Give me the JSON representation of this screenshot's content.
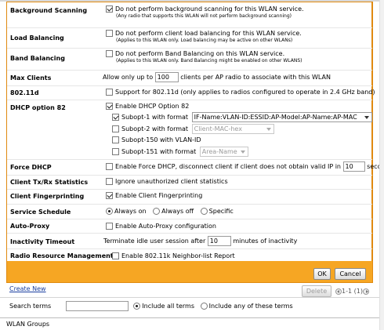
{
  "settings": {
    "background_scanning": {
      "label": "Background Scanning",
      "checked": true,
      "text": "Do not perform background scanning for this WLAN service.",
      "note": "(Any radio that supports this WLAN will not perform background scanning)"
    },
    "load_balancing": {
      "label": "Load Balancing",
      "checked": false,
      "text": "Do not perform client load balancing for this WLAN service.",
      "note": "(Applies to this WLAN only. Load balancing may be active on other WLANs)"
    },
    "band_balancing": {
      "label": "Band Balancing",
      "checked": false,
      "text": "Do not perform Band Balancing on this WLAN service.",
      "note": "(Applies to this WLAN only. Band Balancing might be enabled on other WLANS)"
    },
    "max_clients": {
      "label": "Max Clients",
      "prefix": "Allow only up to",
      "value": "100",
      "suffix": "clients per AP radio to associate with this WLAN"
    },
    "dot11d": {
      "label": "802.11d",
      "checked": false,
      "text": "Support for 802.11d (only applies to radios configured to operate in 2.4 GHz band)"
    },
    "dhcp82": {
      "label": "DHCP option 82",
      "enable": {
        "checked": true,
        "text": "Enable DHCP Option 82"
      },
      "subopt1": {
        "checked": true,
        "text": "Subopt-1 with format",
        "select": "IF-Name:VLAN-ID:ESSID:AP-Model:AP-Name:AP-MAC"
      },
      "subopt2": {
        "checked": false,
        "text": "Subopt-2 with format",
        "select": "Client-MAC-hex"
      },
      "subopt150": {
        "checked": false,
        "text": "Subopt-150 with VLAN-ID"
      },
      "subopt151": {
        "checked": false,
        "text": "Subopt-151 with format",
        "select": "Area-Name"
      }
    },
    "force_dhcp": {
      "label": "Force DHCP",
      "checked": false,
      "text": "Enable Force DHCP, disconnect client if client does not obtain valid IP in",
      "value": "10",
      "suffix": "seconds."
    },
    "client_stats": {
      "label": "Client Tx/Rx Statistics",
      "checked": false,
      "text": "Ignore unauthorized client statistics"
    },
    "fingerprinting": {
      "label": "Client Fingerprinting",
      "checked": true,
      "text": "Enable Client Fingerprinting"
    },
    "schedule": {
      "label": "Service Schedule",
      "options": [
        "Always on",
        "Always off",
        "Specific"
      ],
      "selected": "Always on"
    },
    "auto_proxy": {
      "label": "Auto-Proxy",
      "checked": false,
      "text": "Enable Auto-Proxy configuration"
    },
    "inactivity": {
      "label": "Inactivity Timeout",
      "prefix": "Terminate idle user session after",
      "value": "10",
      "suffix": "minutes of inactivity"
    },
    "rrm": {
      "label": "Radio Resource Management",
      "checked": false,
      "text": "Enable 802.11k Neighbor-list Report"
    }
  },
  "buttons": {
    "ok": "OK",
    "cancel": "Cancel",
    "delete": "Delete"
  },
  "create_new": "Create New",
  "pager": "1-1 (1)",
  "search": {
    "label": "Search terms",
    "value": "",
    "opt_all": "Include all terms",
    "opt_any": "Include any of these terms",
    "selected": "all"
  },
  "section_groups": "WLAN Groups",
  "colors": {
    "frame": "#f6a623",
    "link": "#1a3fa0"
  }
}
